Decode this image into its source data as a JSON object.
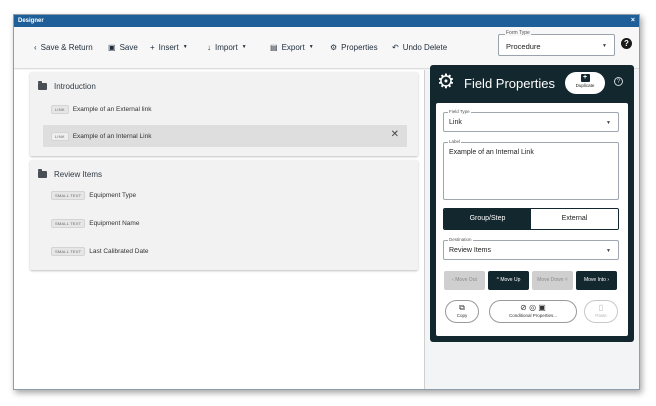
{
  "window": {
    "title": "Designer",
    "close": "×"
  },
  "toolbar": {
    "save_return": "Save & Return",
    "save": "Save",
    "insert": "Insert",
    "import": "Import",
    "export": "Export",
    "properties": "Properties",
    "undo_delete": "Undo Delete",
    "form_type_label": "Form Type",
    "form_type_value": "Procedure",
    "help": "?"
  },
  "groups": [
    {
      "title": "Introduction",
      "items": [
        {
          "tag": "LINK",
          "label": "Example of an External link",
          "selected": false
        },
        {
          "tag": "LINK",
          "label": "Example of an Internal Link",
          "selected": true
        }
      ]
    },
    {
      "title": "Review Items",
      "items": [
        {
          "tag": "SMALL TEXT",
          "label": "Equipment Type",
          "selected": false
        },
        {
          "tag": "SMALL TEXT",
          "label": "Equipment Name",
          "selected": false
        },
        {
          "tag": "SMALL TEXT",
          "label": "Last Calibrated Date",
          "selected": false
        }
      ]
    }
  ],
  "panel": {
    "title": "Field Properties",
    "duplicate": "Duplicate",
    "field_type_label": "Field Type",
    "field_type_value": "Link",
    "label_label": "Label",
    "label_value": "Example of an Internal Link",
    "seg_group_step": "Group/Step",
    "seg_external": "External",
    "destination_label": "Destination",
    "destination_value": "Review Items",
    "move_out": "Move Out",
    "move_up": "Move Up",
    "move_down": "Move Down",
    "move_into": "Move Into",
    "copy": "Copy",
    "conditional_properties": "Conditional Properties...",
    "paste": "Paste"
  },
  "icons": [
    "chevron-left-icon",
    "save-icon",
    "plus-icon",
    "arrow-down-icon",
    "file-icon",
    "gear-icon",
    "undo-icon",
    "caret-down-icon",
    "folder-icon",
    "close-icon",
    "duplicate-icon",
    "help-icon",
    "copy-icon",
    "condition-icon",
    "paste-icon"
  ]
}
